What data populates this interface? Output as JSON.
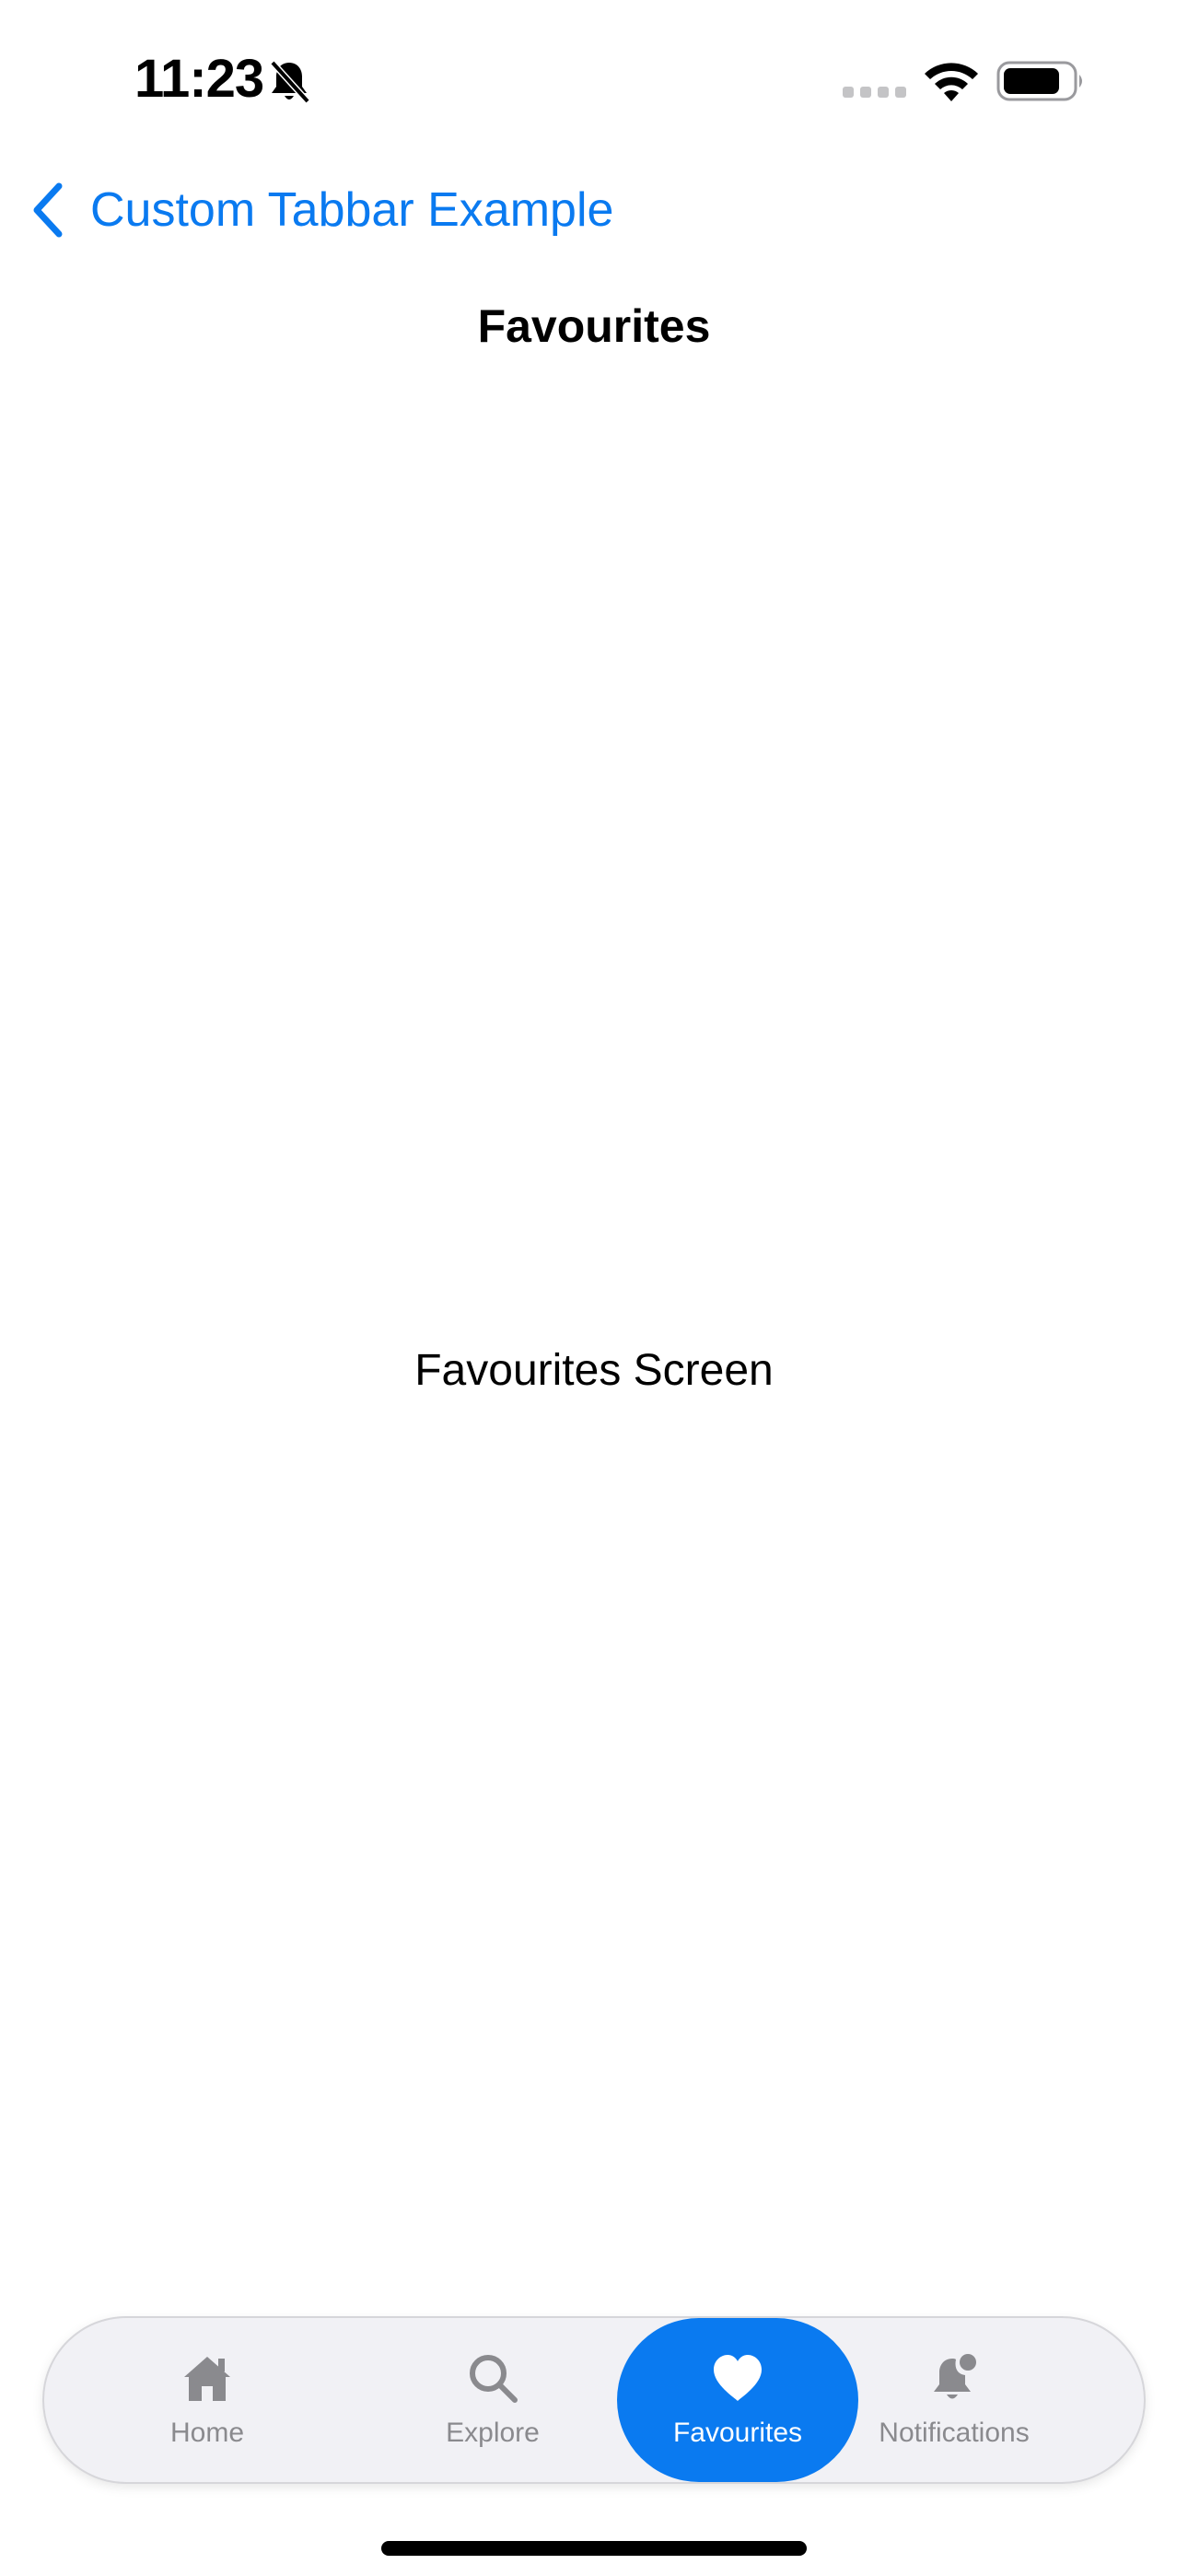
{
  "status_bar": {
    "time": "11:23",
    "icons": [
      "bell-slash-icon",
      "cellular-signal-icon",
      "wifi-icon",
      "battery-icon"
    ]
  },
  "nav": {
    "back_label": "Custom Tabbar Example",
    "title": "Favourites"
  },
  "content": {
    "label": "Favourites Screen"
  },
  "tabbar": {
    "tabs": [
      {
        "label": "Home",
        "icon": "house-icon"
      },
      {
        "label": "Explore",
        "icon": "search-icon"
      },
      {
        "label": "Favourites",
        "icon": "heart-icon",
        "active": true
      },
      {
        "label": "Notifications",
        "icon": "bell-badge-icon"
      }
    ]
  },
  "colors": {
    "accent": "#0a7af0",
    "inactive": "#8a8a8e",
    "tabbar_bg": "#f1f1f5"
  }
}
